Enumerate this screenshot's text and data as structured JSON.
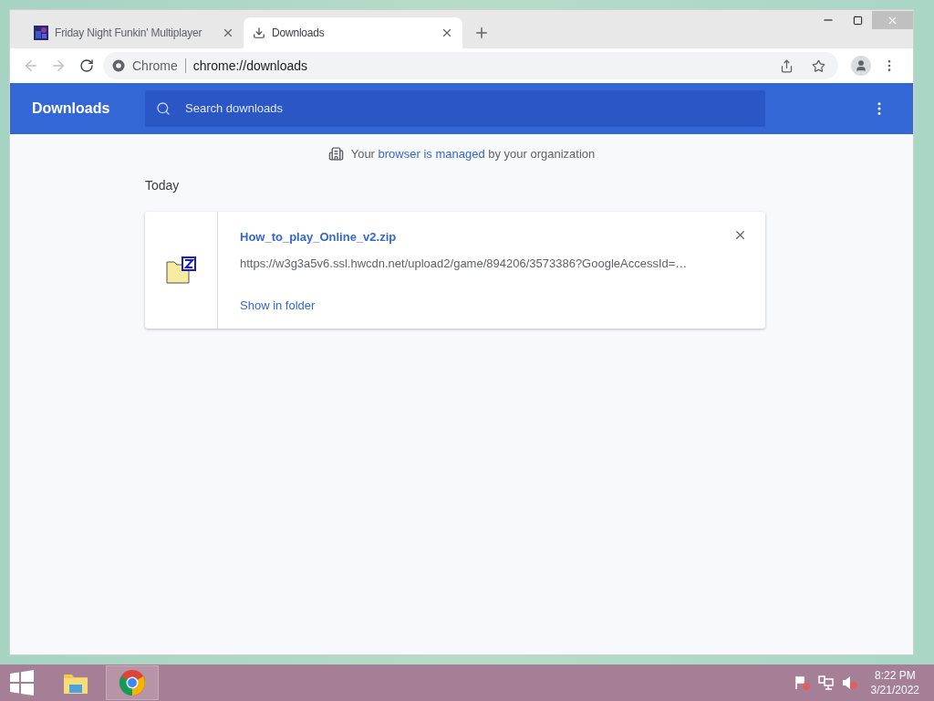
{
  "tabs": [
    {
      "title": "Friday Night Funkin' Multiplayer",
      "kind": "picture-favicon",
      "selected": false
    },
    {
      "title": "Downloads",
      "kind": "download",
      "selected": true
    }
  ],
  "omnibox": {
    "chip": "Chrome",
    "url": "chrome://downloads"
  },
  "header": {
    "title": "Downloads",
    "search": {
      "placeholder": "Search downloads"
    }
  },
  "managed_notice": {
    "before": "Your ",
    "link": "browser is managed",
    "after": " by your organization"
  },
  "section_label": "Today",
  "downloads": [
    {
      "name": "How_to_play_Online_v2.zip",
      "url": "https://w3g3a5v6.ssl.hwcdn.net/upload2/game/894206/3573386?GoogleAccessId=…",
      "action": "Show in folder"
    }
  ],
  "taskbar": {
    "apps": [
      {
        "kind": "explorer",
        "selected": false
      },
      {
        "kind": "chrome",
        "selected": true
      }
    ],
    "clock": {
      "time": "8:22 PM",
      "date": "3/21/2022"
    }
  }
}
